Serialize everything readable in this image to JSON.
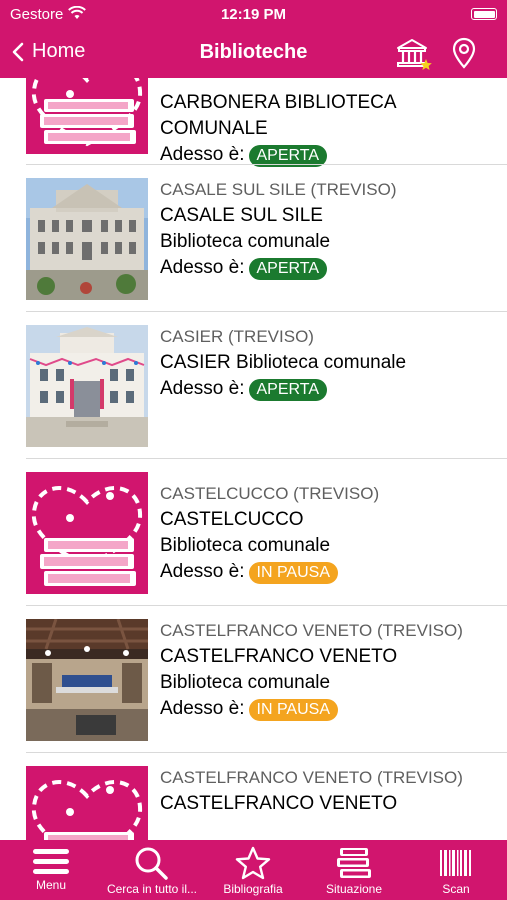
{
  "status_bar": {
    "carrier": "Gestore",
    "time": "12:19 PM"
  },
  "nav": {
    "back_label": "Home",
    "title": "Biblioteche"
  },
  "status_label": "Adesso è:",
  "items": [
    {
      "city": "",
      "name_line1": "CARBONERA BIBLIOTECA",
      "name_line2": "COMUNALE",
      "status": "APERTA",
      "image": "placeholder"
    },
    {
      "city": "CASALE SUL SILE (TREVISO)",
      "name_line1": "CASALE SUL SILE",
      "name_line2": "Biblioteca comunale",
      "status": "APERTA",
      "image": "photo"
    },
    {
      "city": "CASIER (TREVISO)",
      "name_line1": "CASIER Biblioteca comunale",
      "name_line2": "",
      "status": "APERTA",
      "image": "photo"
    },
    {
      "city": "CASTELCUCCO (TREVISO)",
      "name_line1": "CASTELCUCCO",
      "name_line2": "Biblioteca comunale",
      "status": "IN PAUSA",
      "image": "placeholder"
    },
    {
      "city": "CASTELFRANCO VENETO (TREVISO)",
      "name_line1": "CASTELFRANCO VENETO",
      "name_line2": "Biblioteca comunale",
      "status": "IN PAUSA",
      "image": "photo"
    },
    {
      "city": "CASTELFRANCO VENETO (TREVISO)",
      "name_line1": "CASTELFRANCO VENETO",
      "name_line2": "",
      "status": "",
      "image": "placeholder"
    }
  ],
  "tabs": [
    {
      "label": "Menu",
      "icon": "hamburger-icon"
    },
    {
      "label": "Cerca in tutto il...",
      "icon": "search-icon"
    },
    {
      "label": "Bibliografia",
      "icon": "star-icon"
    },
    {
      "label": "Situazione",
      "icon": "books-stack-icon"
    },
    {
      "label": "Scan",
      "icon": "barcode-icon"
    }
  ],
  "colors": {
    "brand": "#d1156e",
    "open": "#1b7a2f",
    "pause": "#f4a41f",
    "city_text": "#5f5f5f"
  }
}
